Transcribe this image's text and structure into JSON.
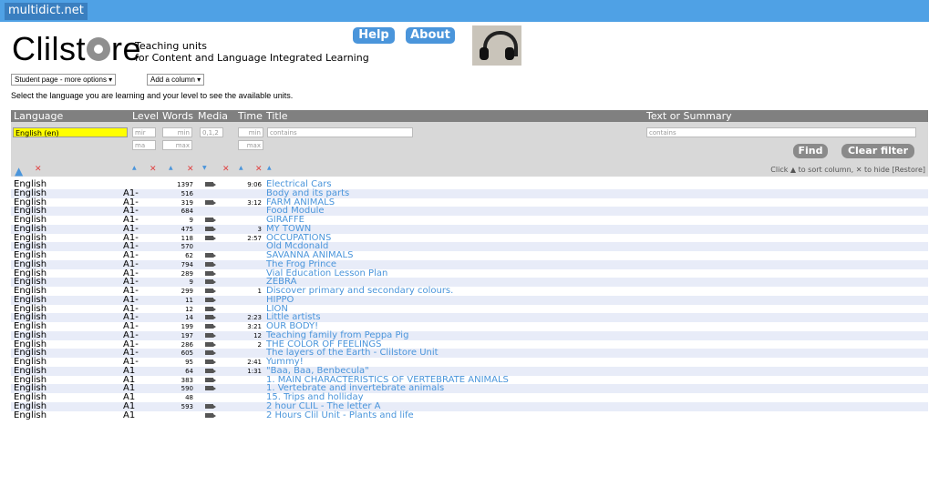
{
  "site": {
    "brand": "multidict.net"
  },
  "header": {
    "logo_text_1": "Clilst",
    "logo_text_2": "re",
    "tagline_1": "Teaching units",
    "tagline_2": "for Content and Language Integrated Learning",
    "help_label": "Help",
    "about_label": "About"
  },
  "controls": {
    "student_page": "Student page - more options ▾",
    "add_column": "Add a column ▾",
    "instruction": "Select the language you are learning and your level to see the available units."
  },
  "table": {
    "headers": {
      "language": "Language",
      "level": "Level",
      "words": "Words",
      "media": "Media",
      "time": "Time",
      "title": "Title",
      "text": "Text or Summary"
    },
    "filters": {
      "language_value": "English (en)",
      "level_min": "mir",
      "level_max": "ma",
      "words_min": "min",
      "words_max": "max",
      "media": "0,1,2",
      "time_min": "min",
      "time_max": "max",
      "title_placeholder": "contains",
      "text_placeholder": "contains"
    },
    "find_label": "Find",
    "clear_label": "Clear filter",
    "hint": "Click ▲ to sort column, ✕ to hide [Restore]",
    "rows": [
      {
        "lang": "English",
        "level": "",
        "words": "1397",
        "media": true,
        "time": "9:06",
        "title": "Electrical Cars"
      },
      {
        "lang": "English",
        "level": "A1-",
        "words": "516",
        "media": false,
        "time": "",
        "title": "Body and its parts"
      },
      {
        "lang": "English",
        "level": "A1-",
        "words": "319",
        "media": true,
        "time": "3:12",
        "title": "FARM ANIMALS"
      },
      {
        "lang": "English",
        "level": "A1-",
        "words": "684",
        "media": false,
        "time": "",
        "title": "Food Module"
      },
      {
        "lang": "English",
        "level": "A1-",
        "words": "9",
        "media": true,
        "time": "",
        "title": "GIRAFFE"
      },
      {
        "lang": "English",
        "level": "A1-",
        "words": "475",
        "media": true,
        "time": "3",
        "title": "MY TOWN"
      },
      {
        "lang": "English",
        "level": "A1-",
        "words": "118",
        "media": true,
        "time": "2:57",
        "title": "OCCUPATIONS"
      },
      {
        "lang": "English",
        "level": "A1-",
        "words": "570",
        "media": false,
        "time": "",
        "title": "Old Mcdonald"
      },
      {
        "lang": "English",
        "level": "A1-",
        "words": "62",
        "media": true,
        "time": "",
        "title": "SAVANNA ANIMALS"
      },
      {
        "lang": "English",
        "level": "A1-",
        "words": "794",
        "media": true,
        "time": "",
        "title": "The Frog Prince"
      },
      {
        "lang": "English",
        "level": "A1-",
        "words": "289",
        "media": true,
        "time": "",
        "title": "Vial Education Lesson Plan"
      },
      {
        "lang": "English",
        "level": "A1-",
        "words": "9",
        "media": true,
        "time": "",
        "title": "ZEBRA"
      },
      {
        "lang": "English",
        "level": "A1-",
        "words": "299",
        "media": true,
        "time": "1",
        "title": "Discover primary and secondary colours."
      },
      {
        "lang": "English",
        "level": "A1-",
        "words": "11",
        "media": true,
        "time": "",
        "title": "HIPPO"
      },
      {
        "lang": "English",
        "level": "A1-",
        "words": "12",
        "media": true,
        "time": "",
        "title": "LION"
      },
      {
        "lang": "English",
        "level": "A1-",
        "words": "14",
        "media": true,
        "time": "2:23",
        "title": "Little artists"
      },
      {
        "lang": "English",
        "level": "A1-",
        "words": "199",
        "media": true,
        "time": "3:21",
        "title": "OUR BODY!"
      },
      {
        "lang": "English",
        "level": "A1-",
        "words": "197",
        "media": true,
        "time": "12",
        "title": "Teaching family from Peppa Pig"
      },
      {
        "lang": "English",
        "level": "A1-",
        "words": "286",
        "media": true,
        "time": "2",
        "title": "THE COLOR OF FEELINGS"
      },
      {
        "lang": "English",
        "level": "A1-",
        "words": "605",
        "media": true,
        "time": "",
        "title": "The layers of the Earth - Clilstore Unit"
      },
      {
        "lang": "English",
        "level": "A1-",
        "words": "95",
        "media": true,
        "time": "2:41",
        "title": "Yummy!"
      },
      {
        "lang": "English",
        "level": "A1",
        "words": "64",
        "media": true,
        "time": "1:31",
        "title": "\"Baa, Baa, Benbecula\""
      },
      {
        "lang": "English",
        "level": "A1",
        "words": "383",
        "media": true,
        "time": "",
        "title": "1. MAIN CHARACTERISTICS OF VERTEBRATE ANIMALS"
      },
      {
        "lang": "English",
        "level": "A1",
        "words": "590",
        "media": true,
        "time": "",
        "title": "1. Vertebrate and invertebrate animals"
      },
      {
        "lang": "English",
        "level": "A1",
        "words": "48",
        "media": false,
        "time": "",
        "title": "15. Trips and holliday"
      },
      {
        "lang": "English",
        "level": "A1",
        "words": "593",
        "media": true,
        "time": "",
        "title": "2 hour CLIL - The letter A"
      },
      {
        "lang": "English",
        "level": "A1",
        "words": "",
        "media": true,
        "time": "",
        "title": "2 Hours Clil Unit - Plants and life"
      }
    ]
  }
}
